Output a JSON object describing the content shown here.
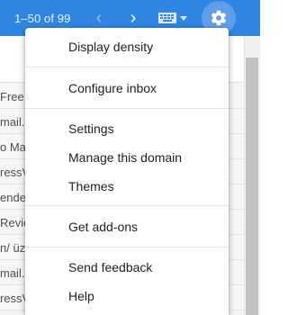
{
  "toolbar": {
    "range_label": "1–50 of 99",
    "prev_icon": "chevron-left-icon",
    "next_icon": "chevron-right-icon",
    "keyboard_icon": "keyboard-icon",
    "settings_icon": "gear-icon",
    "colors": {
      "bar": "#2f86e2",
      "gear_active": "#5e9fe8"
    }
  },
  "mail_rows": [
    "Free T",
    "mail.",
    "o Ma",
    "ressV",
    "ended",
    "Revie",
    "n/ üz",
    "mail.",
    "ressV"
  ],
  "settings_menu": {
    "groups": [
      [
        "Display density"
      ],
      [
        "Configure inbox"
      ],
      [
        "Settings",
        "Manage this domain",
        "Themes"
      ],
      [
        "Get add-ons"
      ],
      [
        "Send feedback",
        "Help"
      ]
    ]
  }
}
